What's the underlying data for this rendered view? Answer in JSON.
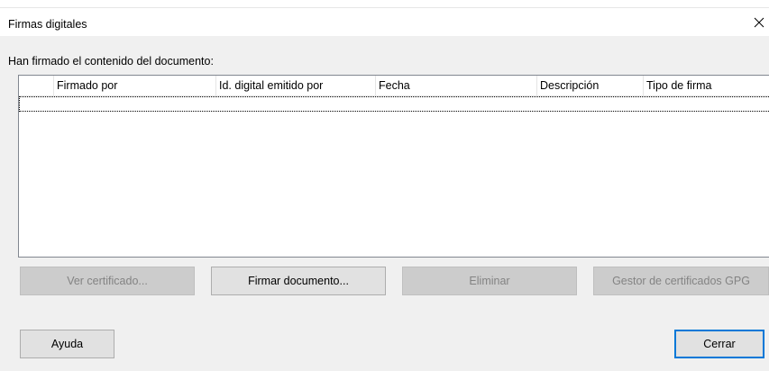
{
  "window": {
    "title": "Firmas digitales"
  },
  "icons": {
    "close": "close-icon"
  },
  "signatures_section": {
    "label": "Han firmado el contenido del documento:",
    "columns": [
      "",
      "Firmado por",
      "Id. digital emitido por",
      "Fecha",
      "Descripción",
      "Tipo de firma"
    ],
    "rows": []
  },
  "actions": {
    "view_certificate": "Ver certificado...",
    "sign_document": "Firmar documento...",
    "remove": "Eliminar",
    "gpg_manager": "Gestor de certificados GPG"
  },
  "footer": {
    "help": "Ayuda",
    "close": "Cerrar"
  }
}
